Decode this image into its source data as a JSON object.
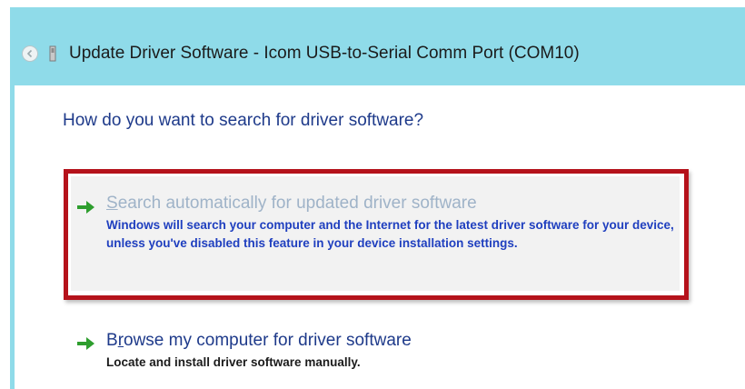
{
  "window": {
    "title": "Update Driver Software - Icom USB-to-Serial Comm Port (COM10)"
  },
  "page": {
    "question": "How do you want to search for driver software?"
  },
  "options": [
    {
      "title_first": "S",
      "title_rest": "earch automatically for updated driver software",
      "description": "Windows will search your computer and the Internet for the latest driver software for your device, unless you've disabled this feature in your device installation settings."
    },
    {
      "title_first": "B",
      "title_underlined": "r",
      "title_rest": "owse my computer for driver software",
      "description": "Locate and install driver software manually."
    }
  ],
  "colors": {
    "titlebar": "#8fdbe9",
    "highlight_border": "#b5121b",
    "link_blue": "#1e3a8a",
    "arrow_green": "#2e9e2e"
  },
  "icons": {
    "back": "back-arrow-icon",
    "app": "usb-device-icon",
    "option_arrow": "green-arrow-icon"
  }
}
